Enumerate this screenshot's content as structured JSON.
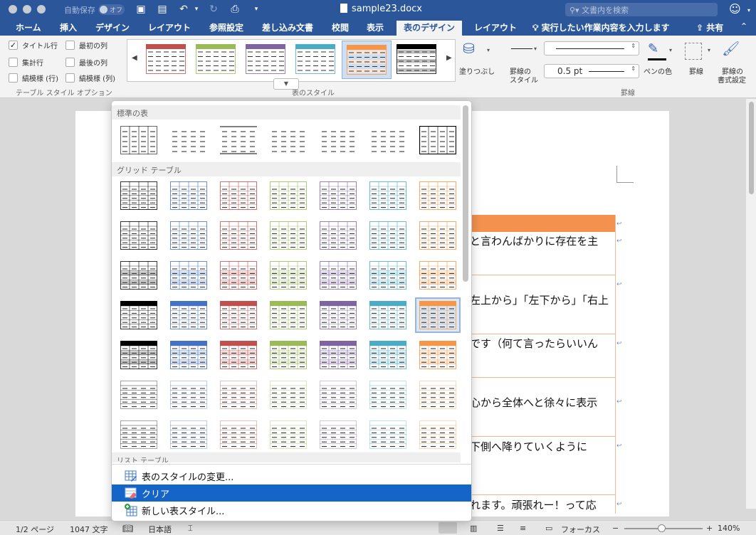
{
  "titlebar": {
    "autosave_label": "自動保存",
    "autosave_state": "オフ",
    "document_name": "sample23.docx",
    "search_placeholder": "文書内を検索"
  },
  "tabs": [
    {
      "label": "ホーム"
    },
    {
      "label": "挿入"
    },
    {
      "label": "デザイン"
    },
    {
      "label": "レイアウト"
    },
    {
      "label": "参照設定"
    },
    {
      "label": "差し込み文書"
    },
    {
      "label": "校閲"
    },
    {
      "label": "表示"
    },
    {
      "label": "表のデザイン",
      "active": true
    },
    {
      "label": "レイアウト"
    }
  ],
  "tell_me": "実行したい作業内容を入力します",
  "share": "共有",
  "ribbon": {
    "options": {
      "header_row": "タイトル行",
      "first_column": "最初の列",
      "total_row": "集計行",
      "last_column": "最後の列",
      "banded_rows": "縞模様 (行)",
      "banded_columns": "縞模様 (列)",
      "group_label": "テーブル スタイル オプション"
    },
    "styles_group_label": "表のスタイル",
    "shading_label": "塗りつぶし",
    "border_styles_label_1": "罫線の",
    "border_styles_label_2": "スタイル",
    "line_weight": "0.5 pt",
    "pen_color_label": "ペンの色",
    "borders_label": "罫線",
    "border_painter_label_1": "罫線の",
    "border_painter_label_2": "書式設定",
    "borders_group_label": "罫線"
  },
  "panel": {
    "section_plain": "標準の表",
    "section_grid": "グリッド テーブル",
    "section_list_partial": "リスト テーブル",
    "menu_modify": "表のスタイルの変更...",
    "menu_clear": "クリア",
    "menu_new": "新しい表スタイル..."
  },
  "document": {
    "lines": [
      "と言わんばかりに存在を主",
      "左上から」「左下から」「右上",
      "です（何て言ったらいいん",
      "心から全体へと徐々に表示",
      "下側へ降りていくように",
      "れます。頑張れー！って応"
    ]
  },
  "statusbar": {
    "page": "1/2 ページ",
    "words": "1047 文字",
    "language": "日本語",
    "focus": "フォーカス",
    "zoom": "140%"
  },
  "colors": {
    "titlebar": "#2b579a",
    "accent_selected_menu": "#1565c8",
    "table_header_orange": "#f4914f",
    "palette": [
      "#000000",
      "#4472c4",
      "#c0504d",
      "#9bbb59",
      "#8064a2",
      "#4bacc6",
      "#f79646"
    ]
  }
}
